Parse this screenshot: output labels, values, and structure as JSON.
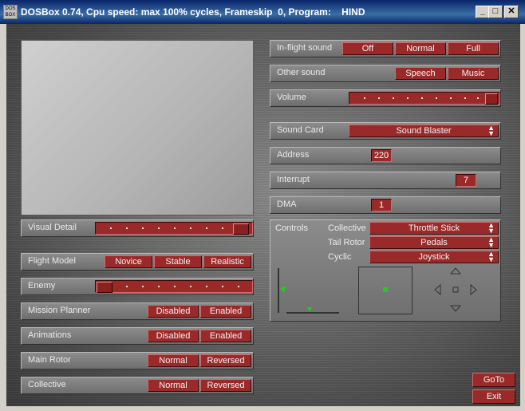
{
  "window": {
    "title": "DOSBox 0.74, Cpu speed: max 100% cycles, Frameskip  0, Program:    HIND",
    "icon_text": "DOS BOX",
    "minimize": "_",
    "maximize": "□",
    "close": "✕"
  },
  "left": {
    "visual_detail": {
      "label": "Visual Detail",
      "level": 1.0
    },
    "flight_model": {
      "label": "Flight Model",
      "options": [
        "Novice",
        "Stable",
        "Realistic"
      ]
    },
    "enemy": {
      "label": "Enemy",
      "level": 0.0
    },
    "mission_planner": {
      "label": "Mission Planner",
      "options": [
        "Disabled",
        "Enabled"
      ]
    },
    "animations": {
      "label": "Animations",
      "options": [
        "Disabled",
        "Enabled"
      ]
    },
    "main_rotor": {
      "label": "Main Rotor",
      "options": [
        "Normal",
        "Reversed"
      ]
    },
    "collective": {
      "label": "Collective",
      "options": [
        "Normal",
        "Reversed"
      ]
    }
  },
  "right": {
    "inflight_sound": {
      "label": "In-flight sound",
      "options": [
        "Off",
        "Normal",
        "Full"
      ]
    },
    "other_sound": {
      "label": "Other sound",
      "options": [
        "Speech",
        "Music"
      ]
    },
    "volume": {
      "label": "Volume",
      "level": 1.0
    },
    "sound_card": {
      "label": "Sound Card",
      "value": "Sound Blaster"
    },
    "address": {
      "label": "Address",
      "value": "220"
    },
    "interrupt": {
      "label": "Interrupt",
      "value": "7"
    },
    "dma": {
      "label": "DMA",
      "value": "1"
    },
    "controls": {
      "label": "Controls",
      "collective": {
        "label": "Collective",
        "value": "Throttle Stick"
      },
      "tail_rotor": {
        "label": "Tail Rotor",
        "value": "Pedals"
      },
      "cyclic": {
        "label": "Cyclic",
        "value": "Joystick"
      }
    }
  },
  "buttons": {
    "goto": "GoTo",
    "exit": "Exit"
  },
  "colors": {
    "accent": "#9a2a2a",
    "panel": "#7c7c7c",
    "indicator": "#22cc22"
  }
}
